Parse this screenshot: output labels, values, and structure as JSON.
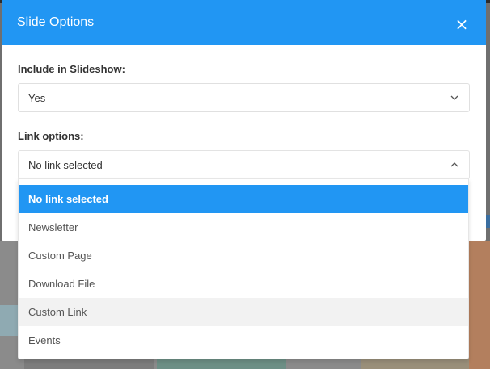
{
  "modal": {
    "title": "Slide Options",
    "close_icon": "close-icon",
    "header_color": "#2196f3"
  },
  "fields": {
    "include": {
      "label": "Include in Slideshow:",
      "value": "Yes",
      "icon": "chevron-down-icon"
    },
    "link": {
      "label": "Link options:",
      "value": "No link selected",
      "icon": "chevron-up-icon",
      "options": [
        {
          "label": "No link selected",
          "state": "selected"
        },
        {
          "label": "Newsletter",
          "state": "normal"
        },
        {
          "label": "Custom Page",
          "state": "normal"
        },
        {
          "label": "Download File",
          "state": "normal"
        },
        {
          "label": "Custom Link",
          "state": "hovered"
        },
        {
          "label": "Events",
          "state": "normal"
        }
      ]
    }
  }
}
